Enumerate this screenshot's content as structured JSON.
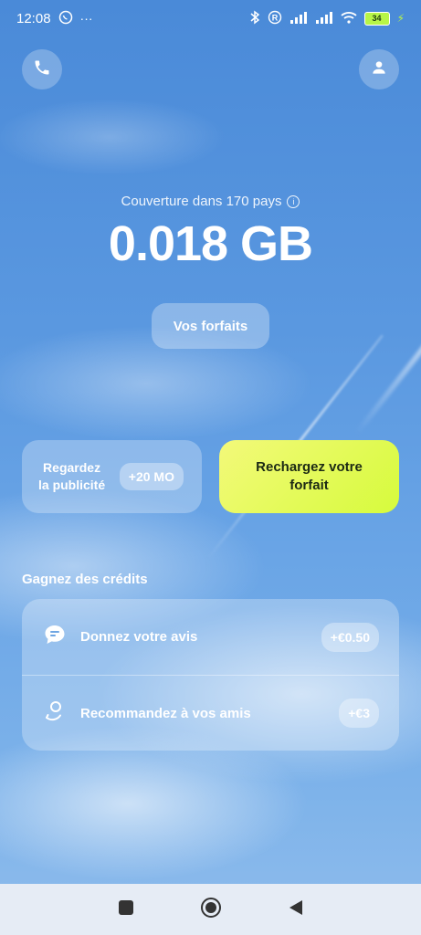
{
  "status_bar": {
    "time": "12:08",
    "battery": "34",
    "icons": [
      "whatsapp-icon",
      "more-icon",
      "bluetooth-icon",
      "registered-icon",
      "signal-icon",
      "signal-icon",
      "wifi-icon",
      "battery-icon",
      "charging-icon"
    ]
  },
  "header": {
    "left_icon": "phone-icon",
    "right_icon": "user-icon"
  },
  "coverage": {
    "text": "Couverture dans 170 pays",
    "info_icon": "i"
  },
  "data_amount": "0.018 GB",
  "plans_button": "Vos forfaits",
  "ad_card": {
    "label_line1": "Regardez",
    "label_line2": "la publicité",
    "badge": "+20 MO"
  },
  "recharge_button": {
    "line1": "Rechargez votre",
    "line2": "forfait"
  },
  "credits": {
    "title": "Gagnez des crédits",
    "items": [
      {
        "label": "Donnez votre avis",
        "badge": "+€0.50",
        "icon": "chat-icon"
      },
      {
        "label": "Recommandez à vos amis",
        "badge": "+€3",
        "icon": "refer-friend-icon"
      }
    ]
  },
  "nav": {
    "icons": [
      "recents-icon",
      "home-icon",
      "back-icon"
    ]
  },
  "colors": {
    "accent": "#d6fb3c",
    "sky": "#5a98e0"
  }
}
